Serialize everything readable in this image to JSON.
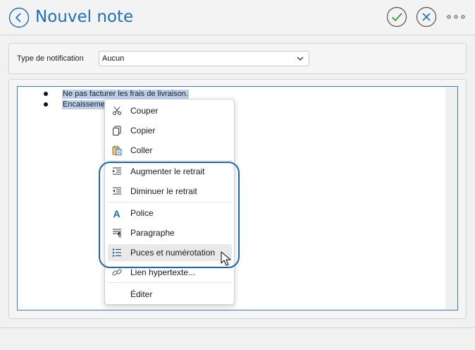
{
  "header": {
    "title": "Nouvel note"
  },
  "notification": {
    "label": "Type de notification",
    "value": "Aucun"
  },
  "editor": {
    "bullets": [
      {
        "text": "Ne pas facturer les frais de livraison."
      },
      {
        "text": "Encaisseme"
      }
    ]
  },
  "context_menu": {
    "items": [
      {
        "label": "Couper",
        "icon": "scissors-icon"
      },
      {
        "label": "Copier",
        "icon": "copy-icon"
      },
      {
        "label": "Coller",
        "icon": "paste-icon"
      },
      {
        "label": "Augmenter le retrait",
        "icon": "indent-increase-icon"
      },
      {
        "label": "Diminuer le retrait",
        "icon": "indent-decrease-icon"
      },
      {
        "label": "Police",
        "icon": "font-icon"
      },
      {
        "label": "Paragraphe",
        "icon": "paragraph-icon"
      },
      {
        "label": "Puces et numérotation",
        "icon": "bullets-icon",
        "hovered": true
      },
      {
        "label": "Lien hypertexte...",
        "icon": "link-icon"
      },
      {
        "label": "Éditer",
        "icon": "none"
      }
    ]
  },
  "colors": {
    "accent": "#1f6fb8",
    "check": "#2e9e3e",
    "selection": "#bcd0ee"
  }
}
